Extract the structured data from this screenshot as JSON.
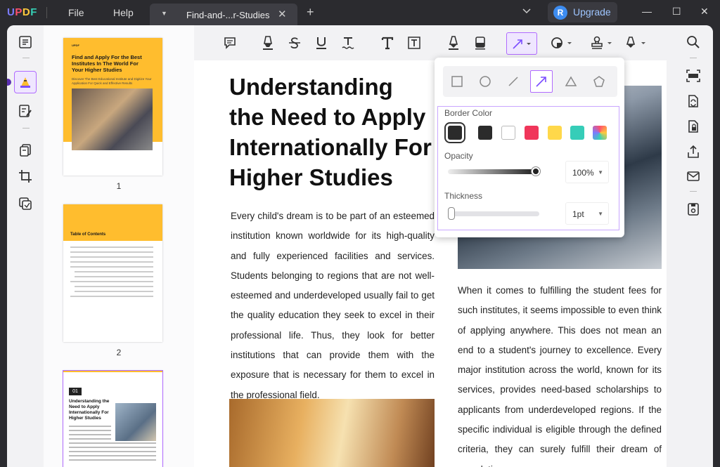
{
  "titlebar": {
    "logo": {
      "u": "U",
      "p": "P",
      "d": "D",
      "f": "F"
    },
    "menu_file": "File",
    "menu_help": "Help",
    "tab_name": "Find-and-...r-Studies",
    "tab_close": "✕",
    "new_tab": "+",
    "upgrade_avatar": "R",
    "upgrade_label": "Upgrade",
    "minimize": "—",
    "maximize": "☐",
    "close": "✕"
  },
  "thumbnails": {
    "page1_number": "1",
    "page2_number": "2",
    "page1_title": "Find and Apply For the Best Institutes In The World For Your Higher Studies",
    "page1_subtitle": "Discover The Best Educational Institute and Digitize Your Application For Quick and Effective Results",
    "page2_heading": "Table of Contents",
    "page3_badge": "01",
    "page3_title": "Understanding the Need to Apply Internationally For Higher Studies"
  },
  "document": {
    "title": "Understanding the Need to Apply Internationally For Higher Studies",
    "title_lines": [
      "Understanding",
      "the Need to Apply",
      "Internationally For",
      "Higher Studies"
    ],
    "left_paragraph": "Every child's dream is to be part of an esteemed institution known worldwide for its high-quality and fully experienced facilities and services. Students belonging to regions that are not well-esteemed and underdeveloped usually fail to get the quality education they seek to excel in their professional life. Thus, they look for better institutions that can provide them with the exposure that is necessary for them to excel in the professional field.",
    "right_paragraph": "When it comes to fulfilling the student fees for such institutes, it seems impossible to even think of applying anywhere. This does not mean an end to a student's journey to excellence. Every major institution across the world, known for its services, provides need-based scholarships to applicants from underdeveloped regions. If the specific individual is eligible through the defined criteria, they can surely fulfill their dream of completing"
  },
  "shape_popup": {
    "border_color_label": "Border Color",
    "opacity_label": "Opacity",
    "opacity_value": "100%",
    "opacity_level": 1.0,
    "thickness_label": "Thickness",
    "thickness_value": "1pt",
    "swatch_colors": [
      "#2b2b2b",
      "#2b2b2b",
      "#ffffff",
      "#f0365a",
      "#ffd84a",
      "#36cdb8",
      "gradient"
    ],
    "selected_shape": "arrow",
    "shapes": [
      "rectangle-icon",
      "circle-icon",
      "line-icon",
      "arrow-icon",
      "triangle-icon",
      "pentagon-icon"
    ]
  },
  "colors": {
    "accent": "#b06bff",
    "yellow": "#ffbd2e"
  }
}
